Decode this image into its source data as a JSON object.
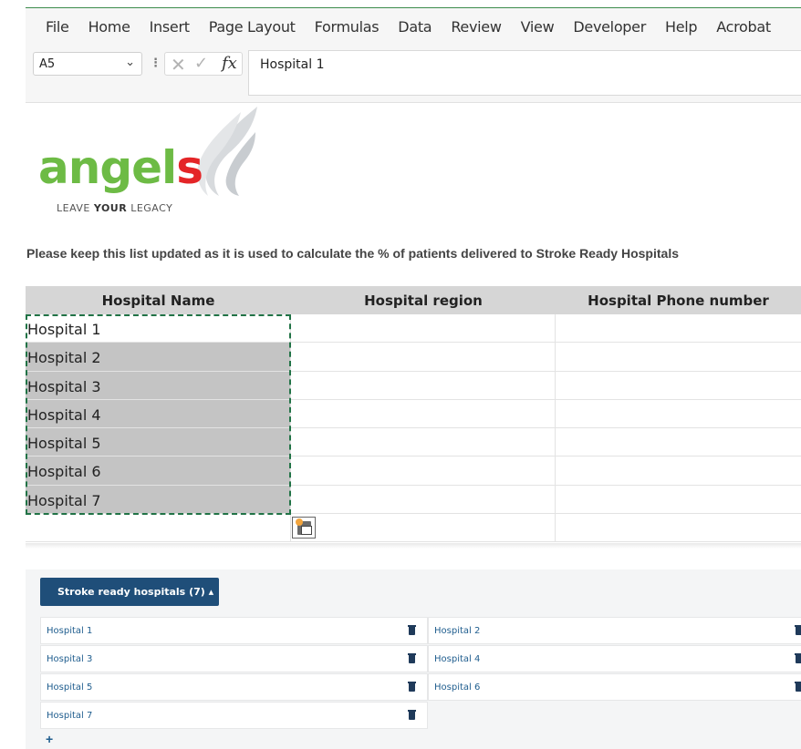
{
  "menu": [
    "File",
    "Home",
    "Insert",
    "Page Layout",
    "Formulas",
    "Data",
    "Review",
    "View",
    "Developer",
    "Help",
    "Acrobat"
  ],
  "formula_bar": {
    "name_box": "A5",
    "formula": "Hospital 1"
  },
  "logo": {
    "word_green": "angel",
    "word_red": "s",
    "tagline_a": "LEAVE ",
    "tagline_b": "YOUR",
    "tagline_c": " LEGACY"
  },
  "notice": "Please keep this list updated as it is used to calculate the % of patients delivered to Stroke Ready Hospitals",
  "table": {
    "headers": [
      "Hospital Name",
      "Hospital region",
      "Hospital Phone number"
    ],
    "rows": [
      "Hospital 1",
      "Hospital 2",
      "Hospital 3",
      "Hospital 4",
      "Hospital 5",
      "Hospital 6",
      "Hospital 7",
      ""
    ]
  },
  "panel": {
    "toggle_label": "Stroke ready hospitals (7) ▴",
    "items": [
      "Hospital 1",
      "Hospital 2",
      "Hospital 3",
      "Hospital 4",
      "Hospital 5",
      "Hospital 6",
      "Hospital 7"
    ],
    "add_label": "+"
  }
}
